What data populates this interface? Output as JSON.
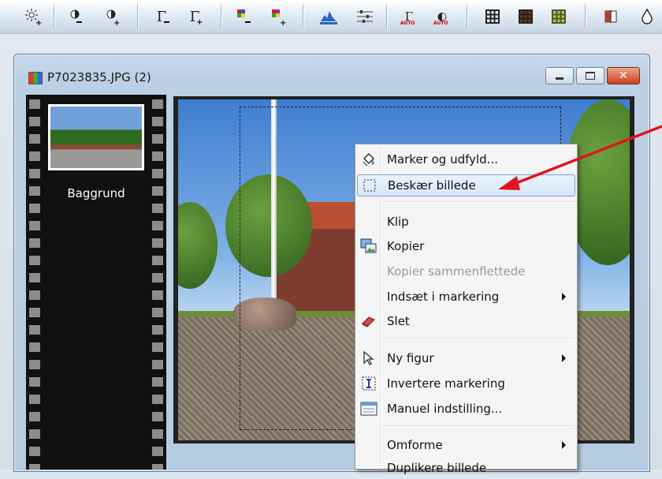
{
  "colors": {
    "menu_highlight": "#d5e7fa",
    "annotation_arrow": "#e0141e",
    "film_strip": "#111111"
  },
  "toolbar": {
    "buttons": [
      {
        "name": "brightness-plus-icon"
      },
      {
        "name": "contrast-minus-icon"
      },
      {
        "name": "contrast-plus-icon"
      },
      {
        "name": "gamma-minus-icon",
        "glyph": "Γ",
        "sub": "−"
      },
      {
        "name": "gamma-plus-icon",
        "glyph": "Γ",
        "sub": "+"
      },
      {
        "name": "color-minus-icon"
      },
      {
        "name": "color-plus-icon"
      },
      {
        "name": "histogram-icon"
      },
      {
        "name": "levels-icon"
      },
      {
        "name": "auto-gamma-icon",
        "glyph": "Γ",
        "sub": "+",
        "badge": "AUTO"
      },
      {
        "name": "auto-contrast-icon",
        "glyph": "◐",
        "sub": "+",
        "badge": "AUTO"
      },
      {
        "name": "grid-icon"
      },
      {
        "name": "dark-grid-icon"
      },
      {
        "name": "green-grid-icon"
      },
      {
        "name": "split-view-icon"
      },
      {
        "name": "drop-icon"
      }
    ]
  },
  "window": {
    "title": "P7023835.JPG (2)",
    "minimize_label": "minimize",
    "maximize_label": "maximize",
    "close_glyph": "✕"
  },
  "filmstrip": {
    "items": [
      {
        "label": "Baggrund"
      }
    ]
  },
  "context_menu": {
    "items": [
      {
        "label": "Marker og udfyld...",
        "icon": "fill-bucket-icon",
        "enabled": true
      },
      {
        "label": "Beskær billede",
        "icon": "crop-selection-icon",
        "enabled": true,
        "highlighted": true
      },
      {
        "label": "Klip",
        "icon": "",
        "enabled": true
      },
      {
        "label": "Kopier",
        "icon": "copy-image-icon",
        "enabled": true
      },
      {
        "label": "Kopier sammenflettede",
        "icon": "",
        "enabled": false
      },
      {
        "label": "Indsæt i markering",
        "icon": "",
        "enabled": true,
        "submenu": true
      },
      {
        "label": "Slet",
        "icon": "eraser-icon",
        "enabled": true
      },
      {
        "label": "Ny figur",
        "icon": "cursor-icon",
        "enabled": true,
        "submenu": true
      },
      {
        "label": "Invertere markering",
        "icon": "invert-selection-icon",
        "enabled": true
      },
      {
        "label": "Manuel indstilling...",
        "icon": "manual-setting-icon",
        "enabled": true
      },
      {
        "label": "Omforme",
        "icon": "",
        "enabled": true,
        "submenu": true
      },
      {
        "label": "Duplikere billede",
        "icon": "",
        "enabled": true
      }
    ]
  }
}
